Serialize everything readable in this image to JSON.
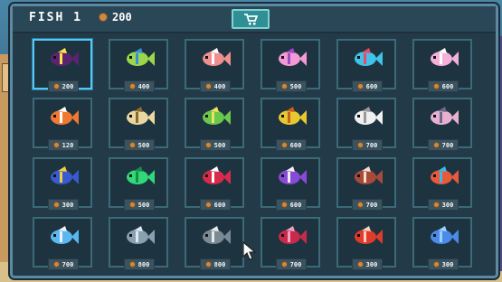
{
  "header": {
    "title": "FISH 1",
    "coins": "200",
    "shop_icon": "cart-icon"
  },
  "colors": {
    "panel": "#233a48",
    "card_border": "#3c6a78",
    "selected_border": "#58c8f0",
    "coin": "#c98b45",
    "shop_button": "#2f8f94"
  },
  "rows": [
    [
      {
        "name": "purple-angelfish",
        "price": "200",
        "color": "#5b2470",
        "accent": "#ffe14a",
        "selected": true
      },
      {
        "name": "yellow-green-fish",
        "price": "400",
        "color": "#9ad84a",
        "accent": "#3a8fd8"
      },
      {
        "name": "pink-salmon",
        "price": "400",
        "color": "#f08f8f",
        "accent": "#ffffff"
      },
      {
        "name": "pink-pufferfish",
        "price": "500",
        "color": "#f29ad6",
        "accent": "#a04ac0"
      },
      {
        "name": "cyan-fish",
        "price": "600",
        "color": "#3fc3e8",
        "accent": "#e84a6a"
      },
      {
        "name": "pink-axolotl",
        "price": "600",
        "color": "#f4b0d8",
        "accent": "#ffffff"
      }
    ],
    [
      {
        "name": "clownfish",
        "price": "120",
        "color": "#f07830",
        "accent": "#ffffff"
      },
      {
        "name": "pufferfish",
        "price": "500",
        "color": "#e8d8a0",
        "accent": "#8a6a30"
      },
      {
        "name": "green-fish",
        "price": "500",
        "color": "#6ac84a",
        "accent": "#f0e060"
      },
      {
        "name": "yellow-frogfish",
        "price": "600",
        "color": "#e8c830",
        "accent": "#c8601a"
      },
      {
        "name": "skeleton-fish",
        "price": "700",
        "color": "#f0f0f0",
        "accent": "#9a9a9a"
      },
      {
        "name": "zombie-fish",
        "price": "700",
        "color": "#e8b0d0",
        "accent": "#6a6a8a"
      }
    ],
    [
      {
        "name": "blue-tang",
        "price": "300",
        "color": "#3a5ad0",
        "accent": "#f0d040"
      },
      {
        "name": "green-turtle",
        "price": "500",
        "color": "#30d878",
        "accent": "#1a8a48"
      },
      {
        "name": "red-piranha",
        "price": "600",
        "color": "#d82a4a",
        "accent": "#ffffff"
      },
      {
        "name": "purple-fish",
        "price": "600",
        "color": "#8a4ad8",
        "accent": "#f0f0f0"
      },
      {
        "name": "brown-piranha",
        "price": "700",
        "color": "#a84a3a",
        "accent": "#f0e0d0"
      },
      {
        "name": "rainbow-fish",
        "price": "300",
        "color": "#e85a3a",
        "accent": "#3ab8e8"
      }
    ],
    [
      {
        "name": "jellyfish",
        "price": "700",
        "color": "#5ab8f0",
        "accent": "#f0f0ff"
      },
      {
        "name": "dolphin",
        "price": "800",
        "color": "#8aa0b0",
        "accent": "#e0e8f0"
      },
      {
        "name": "shark",
        "price": "800",
        "color": "#7a8a94",
        "accent": "#e8e8e8"
      },
      {
        "name": "red-sea-slug",
        "price": "700",
        "color": "#c82a4a",
        "accent": "#f0a0c0"
      },
      {
        "name": "crab",
        "price": "300",
        "color": "#e03a2a",
        "accent": "#ffd0c0"
      },
      {
        "name": "blue-slime",
        "price": "300",
        "color": "#4a8ae8",
        "accent": "#a0d0ff"
      }
    ]
  ]
}
